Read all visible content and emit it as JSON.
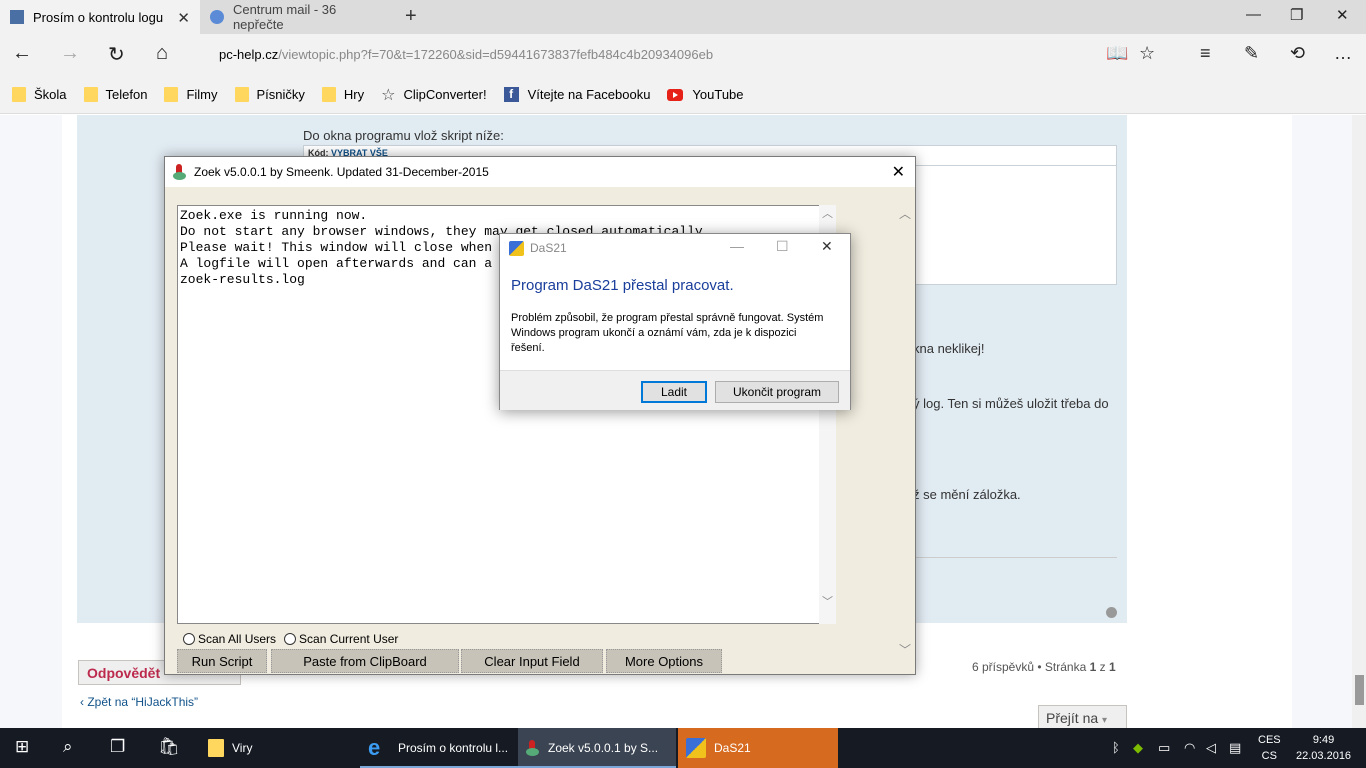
{
  "browser": {
    "tabs": [
      {
        "title": "Prosím o kontrolu logu",
        "active": true
      },
      {
        "title": "Centrum mail - 36 nepřečte",
        "active": false
      }
    ],
    "url_host": "pc-help.cz",
    "url_path": "/viewtopic.php?f=70&t=172260&sid=d59441673837fefb484c4b20934096eb",
    "favorites": [
      {
        "label": "Škola",
        "icon": "folder-icon"
      },
      {
        "label": "Telefon",
        "icon": "folder-icon"
      },
      {
        "label": "Filmy",
        "icon": "folder-icon"
      },
      {
        "label": "Písničky",
        "icon": "folder-icon"
      },
      {
        "label": "Hry",
        "icon": "folder-icon"
      },
      {
        "label": "ClipConverter!",
        "icon": "star-icon"
      },
      {
        "label": "Vítejte na Facebooku",
        "icon": "facebook-icon"
      },
      {
        "label": "YouTube",
        "icon": "youtube-icon"
      }
    ]
  },
  "page": {
    "instruction": "Do okna programu vlož skript níže:",
    "code_label": "Kód:",
    "code_select": "VYBRAT VŠE",
    "text_fragments": {
      "a": "kna neklikej!",
      "b": "ý log. Ten si můžeš uložit třeba do",
      "c": "ž se mění záložka."
    },
    "reply_button": "Odpovědět",
    "page_info_prefix": "6 příspěvků • Stránka",
    "page_info_current": "1",
    "page_info_sep": "z",
    "page_info_total": "1",
    "back_link": "Zpět na “HiJackThis”",
    "goto_button": "Přejít na"
  },
  "zoek": {
    "title": "Zoek v5.0.0.1 by Smeenk. Updated 31-December-2015",
    "lines": [
      "Zoek.exe is running now.",
      "Do not start any browser windows, they may get closed automatically.",
      "Please wait! This window will close when",
      "A logfile will open afterwards and can a",
      "zoek-results.log"
    ],
    "radio_all": "Scan All Users",
    "radio_current": "Scan Current User",
    "buttons": {
      "run": "Run Script",
      "paste": "Paste from ClipBoard",
      "clear": "Clear Input Field",
      "more": "More Options"
    }
  },
  "das21": {
    "title": "DaS21",
    "heading": "Program DaS21 přestal pracovat.",
    "message": "Problém způsobil, že program přestal správně fungovat. Systém Windows program ukončí a oznámí vám, zda je k dispozici řešení.",
    "btn_debug": "Ladit",
    "btn_close": "Ukončit program"
  },
  "taskbar": {
    "apps": [
      {
        "label": "Viry",
        "icon": "folder-icon"
      },
      {
        "label": "Prosím o kontrolu l...",
        "icon": "edge-icon"
      },
      {
        "label": "Zoek v5.0.0.1 by S...",
        "icon": "zoek-icon"
      },
      {
        "label": "DaS21",
        "icon": "das21-icon"
      }
    ],
    "lang_top": "CES",
    "lang_bottom": "CS",
    "time": "9:49",
    "date": "22.03.2016"
  },
  "colors": {
    "accent": "#0078d7",
    "taskbar_flash": "#d66a1e",
    "dialog_heading": "#1a3e9b",
    "phpbb_red": "#bc2a4d"
  }
}
